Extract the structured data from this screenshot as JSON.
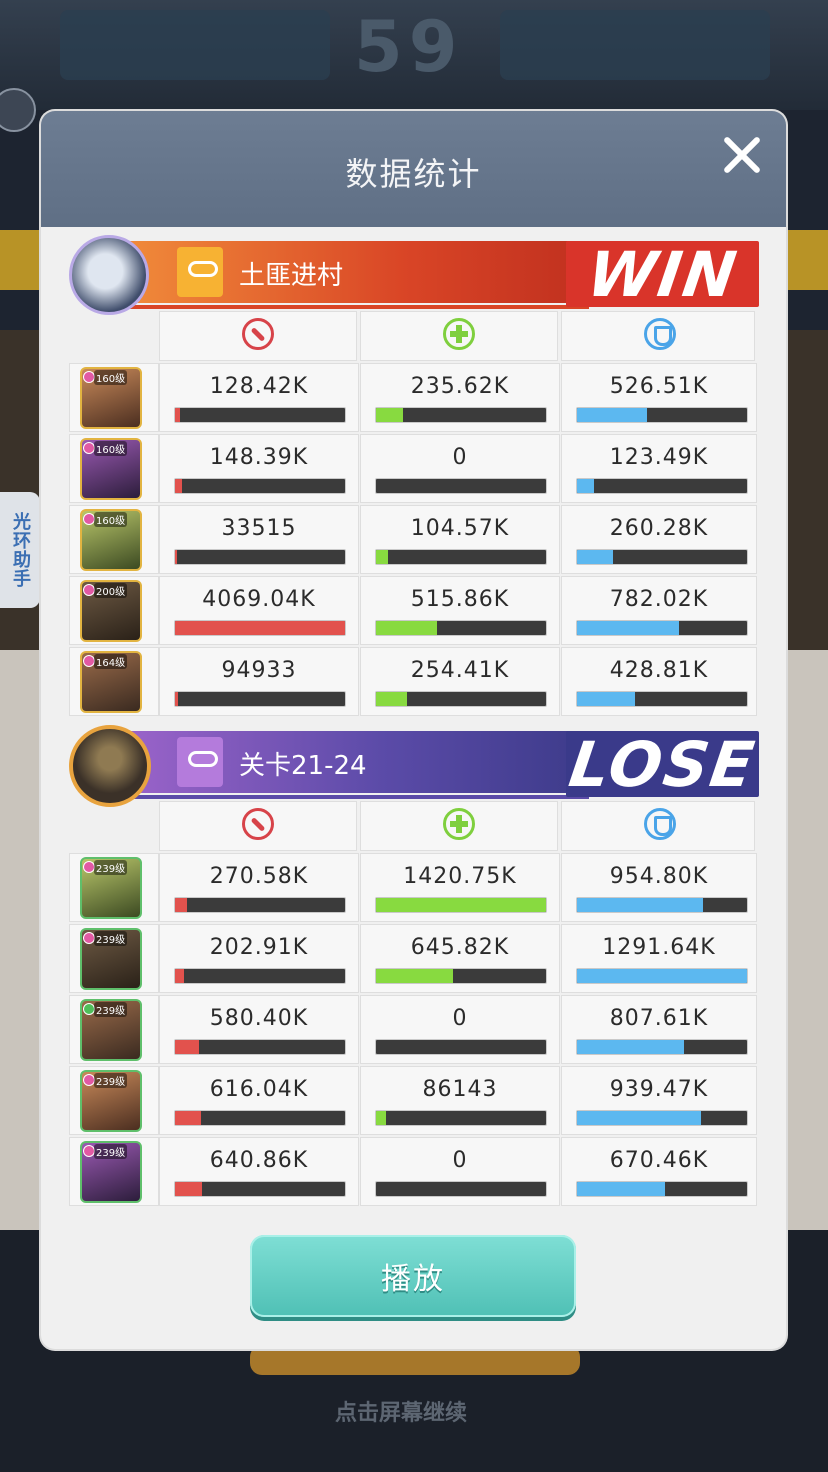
{
  "background": {
    "score_text": "59",
    "bottom_text": "点击屏幕继续"
  },
  "side_tab": {
    "label": "光环助手"
  },
  "dialog": {
    "title": "数据统计",
    "close_icon": "close-icon",
    "stat_icons": [
      "damage-icon",
      "heal-icon",
      "shield-icon"
    ],
    "teams": [
      {
        "name": "土匪进村",
        "result": "WIN",
        "result_color": "#d9342a",
        "avatar_label": "白月光",
        "heroes": [
          {
            "level": "160级",
            "damage": "128.42K",
            "damage_pct": 0.03,
            "heal": "235.62K",
            "heal_pct": 0.16,
            "shield": "526.51K",
            "shield_pct": 0.41
          },
          {
            "level": "160级",
            "damage": "148.39K",
            "damage_pct": 0.04,
            "heal": "0",
            "heal_pct": 0,
            "shield": "123.49K",
            "shield_pct": 0.1
          },
          {
            "level": "160级",
            "damage": "33515",
            "damage_pct": 0.01,
            "heal": "104.57K",
            "heal_pct": 0.07,
            "shield": "260.28K",
            "shield_pct": 0.21
          },
          {
            "level": "200级",
            "damage": "4069.04K",
            "damage_pct": 1.0,
            "heal": "515.86K",
            "heal_pct": 0.36,
            "shield": "782.02K",
            "shield_pct": 0.6
          },
          {
            "level": "164级",
            "damage": "94933",
            "damage_pct": 0.02,
            "heal": "254.41K",
            "heal_pct": 0.18,
            "shield": "428.81K",
            "shield_pct": 0.34
          }
        ]
      },
      {
        "name": "关卡21-24",
        "result": "LOSE",
        "result_color": "#3a3a8a",
        "avatar_label": "",
        "heroes": [
          {
            "level": "239级",
            "damage": "270.58K",
            "damage_pct": 0.07,
            "heal": "1420.75K",
            "heal_pct": 1.0,
            "shield": "954.80K",
            "shield_pct": 0.74
          },
          {
            "level": "239级",
            "damage": "202.91K",
            "damage_pct": 0.05,
            "heal": "645.82K",
            "heal_pct": 0.45,
            "shield": "1291.64K",
            "shield_pct": 1.0
          },
          {
            "level": "239级",
            "damage": "580.40K",
            "damage_pct": 0.14,
            "heal": "0",
            "heal_pct": 0,
            "shield": "807.61K",
            "shield_pct": 0.63
          },
          {
            "level": "239级",
            "damage": "616.04K",
            "damage_pct": 0.15,
            "heal": "86143",
            "heal_pct": 0.06,
            "shield": "939.47K",
            "shield_pct": 0.73
          },
          {
            "level": "239级",
            "damage": "640.86K",
            "damage_pct": 0.16,
            "heal": "0",
            "heal_pct": 0,
            "shield": "670.46K",
            "shield_pct": 0.52
          }
        ]
      }
    ],
    "play_button": "播放"
  }
}
